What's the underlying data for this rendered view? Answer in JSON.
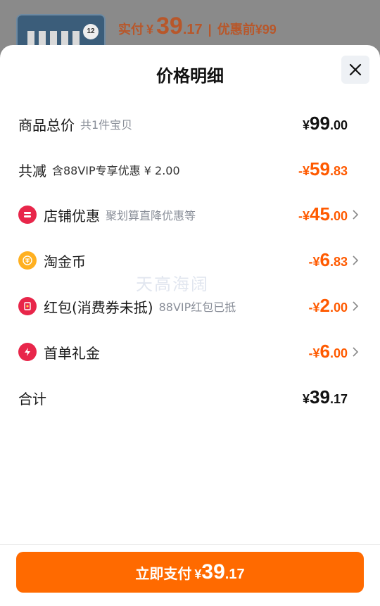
{
  "background": {
    "paid_label": "实付",
    "currency": "¥",
    "paid_int": "39",
    "paid_dec": ".17",
    "separator": "|",
    "before_label": "优惠前",
    "before_price": "¥99",
    "thumb_badge": "12"
  },
  "sheet": {
    "title": "价格明细"
  },
  "rows": {
    "total": {
      "label": "商品总价",
      "sub": "共1件宝贝",
      "sign": "",
      "cur": "¥",
      "int": "99",
      "dec": ".00"
    },
    "reduce": {
      "label": "共减",
      "sub": "含88VIP专享优惠 ¥ 2.00",
      "sign": "-",
      "cur": "¥",
      "int": "59",
      "dec": ".83"
    },
    "store": {
      "label": "店铺优惠",
      "sub": "聚划算直降优惠等",
      "sign": "-",
      "cur": "¥",
      "int": "45",
      "dec": ".00"
    },
    "coins": {
      "label": "淘金币",
      "sub": "",
      "sign": "-",
      "cur": "¥",
      "int": "6",
      "dec": ".83"
    },
    "redpacket": {
      "label": "红包(消费券未抵)",
      "sub": "88VIP红包已抵",
      "sign": "-",
      "cur": "¥",
      "int": "2",
      "dec": ".00"
    },
    "firstorder": {
      "label": "首单礼金",
      "sub": "",
      "sign": "-",
      "cur": "¥",
      "int": "6",
      "dec": ".00"
    },
    "sum": {
      "label": "合计",
      "sign": "",
      "cur": "¥",
      "int": "39",
      "dec": ".17"
    }
  },
  "watermark": "天高海阔",
  "pay_button": {
    "label": "立即支付",
    "cur": "¥",
    "int": "39",
    "dec": ".17"
  },
  "colors": {
    "accent": "#ff6a00",
    "discount": "#ff5a00",
    "store_icon": "#e8264a",
    "coin_icon": "#ffb020",
    "redpacket_icon": "#e8264a",
    "firstorder_icon": "#e8264a"
  },
  "icons": {
    "close": "close-icon",
    "store": "store-icon",
    "coins": "coin-icon",
    "redpacket": "red-packet-icon",
    "firstorder": "lightning-icon",
    "chevron": "chevron-right-icon"
  }
}
